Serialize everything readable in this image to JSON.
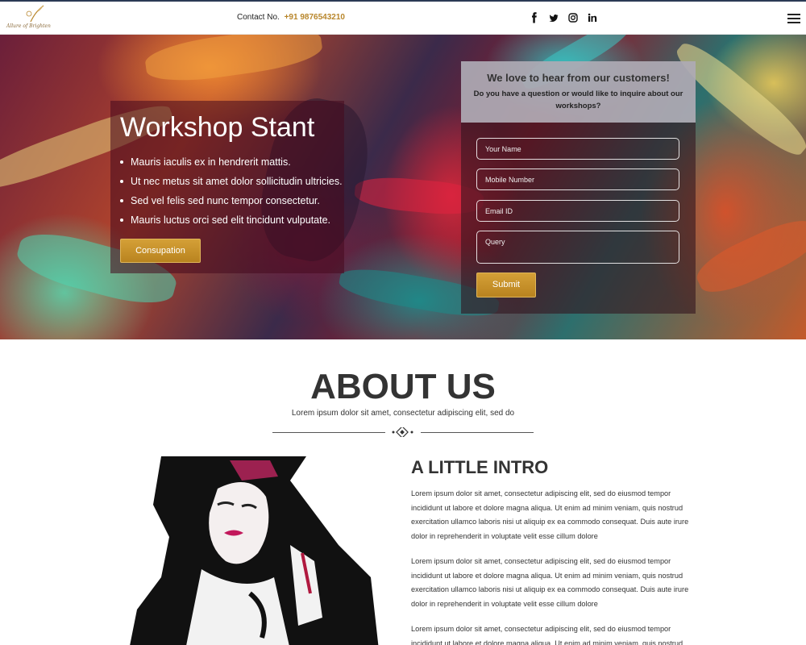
{
  "header": {
    "logo_text": "Allure of Brighten",
    "contact_label": "Contact No.",
    "contact_number": "+91 9876543210",
    "social": [
      "facebook-icon",
      "twitter-icon",
      "instagram-icon",
      "linkedin-icon"
    ],
    "menu_icon": "hamburger-icon"
  },
  "hero": {
    "title": "Workshop Stant",
    "bullets": [
      "Mauris iaculis ex in hendrerit mattis.",
      "Ut nec metus sit amet dolor sollicitudin ultricies.",
      "Sed vel felis sed nunc tempor consectetur.",
      "Mauris luctus orci sed elit tincidunt vulputate."
    ],
    "button_label": "Consupation"
  },
  "form": {
    "title": "We love to hear from our customers!",
    "subtitle": "Do you have a question or would like to inquire about our workshops?",
    "name_placeholder": "Your Name",
    "mobile_placeholder": "Mobile Number",
    "email_placeholder": "Email ID",
    "query_placeholder": "Query",
    "submit_label": "Submit"
  },
  "about": {
    "title": "ABOUT US",
    "subtitle": "Lorem ipsum dolor sit amet, consectetur adipiscing elit, sed do",
    "intro_title": "A LITTLE INTRO",
    "paragraphs": [
      "Lorem ipsum dolor sit amet, consectetur adipiscing elit, sed do eiusmod tempor incididunt ut labore et dolore magna aliqua. Ut enim ad minim veniam, quis nostrud exercitation ullamco laboris nisi ut aliquip ex ea commodo consequat. Duis aute irure dolor in reprehenderit in voluptate velit esse cillum dolore",
      "Lorem ipsum dolor sit amet, consectetur adipiscing elit, sed do eiusmod tempor incididunt ut labore et dolore magna aliqua. Ut enim ad minim veniam, quis nostrud exercitation ullamco laboris nisi ut aliquip ex ea commodo consequat. Duis aute irure dolor in reprehenderit in voluptate velit esse cillum dolore",
      "Lorem ipsum dolor sit amet, consectetur adipiscing elit, sed do eiusmod tempor incididunt ut labore et dolore magna aliqua. Ut enim ad minim veniam, quis nostrud"
    ]
  },
  "colors": {
    "accent_gold": "#b8862b",
    "text_dark": "#333333"
  }
}
